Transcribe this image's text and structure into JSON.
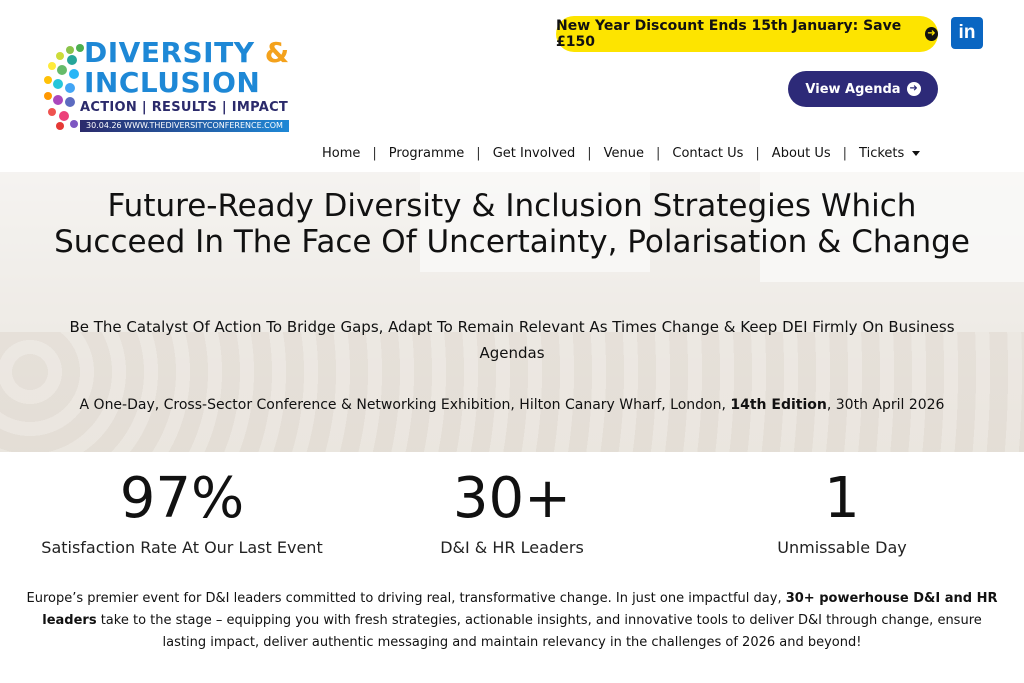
{
  "logo": {
    "line1": "DIVERSITY",
    "amp": "&",
    "line2": "INCLUSION",
    "tagline": "ACTION | RESULTS | IMPACT",
    "date_url": "30.04.26  WWW.THEDIVERSITYCONFERENCE.COM",
    "colors": {
      "primary": "#1e88d6",
      "accent": "#f4a21c",
      "navy": "#2b2a6b"
    }
  },
  "promo": {
    "label": "New Year Discount Ends 15th January: Save £150",
    "icon": "arrow-circle-right-icon",
    "color": "#fde400"
  },
  "social": {
    "linkedin_label": "in",
    "color": "#0a66c2"
  },
  "agenda": {
    "label": "View Agenda",
    "icon": "arrow-circle-right-icon",
    "color": "#2d2a78"
  },
  "nav": {
    "items": [
      "Home",
      "Programme",
      "Get Involved",
      "Venue",
      "Contact Us",
      "About Us",
      "Tickets"
    ],
    "separator": "|"
  },
  "hero": {
    "title": "Future-Ready Diversity & Inclusion Strategies Which Succeed In The Face Of Uncertainty, Polarisation & Change",
    "subtitle": "Be The Catalyst Of Action To Bridge Gaps, Adapt To Remain Relevant As Times Change & Keep DEI Firmly On Business Agendas",
    "line_pre": "A One-Day, Cross-Sector Conference & Networking Exhibition, Hilton Canary Wharf, London, ",
    "line_bold": "14th Edition",
    "line_post": ", 30th April 2026"
  },
  "stats": [
    {
      "value": "97%",
      "label": "Satisfaction Rate At Our Last Event"
    },
    {
      "value": "30+",
      "label": "D&I & HR Leaders"
    },
    {
      "value": "1",
      "label": "Unmissable Day"
    }
  ],
  "description": {
    "pre": "Europe’s premier event for D&I leaders committed to driving real, transformative change. In just one impactful day, ",
    "bold": "30+ powerhouse D&I and HR leaders",
    "post": " take to the stage – equipping you with fresh strategies, actionable insights, and innovative tools to deliver D&I through change, ensure lasting impact, deliver authentic messaging and maintain relevancy in the challenges of 2026 and beyond!"
  }
}
